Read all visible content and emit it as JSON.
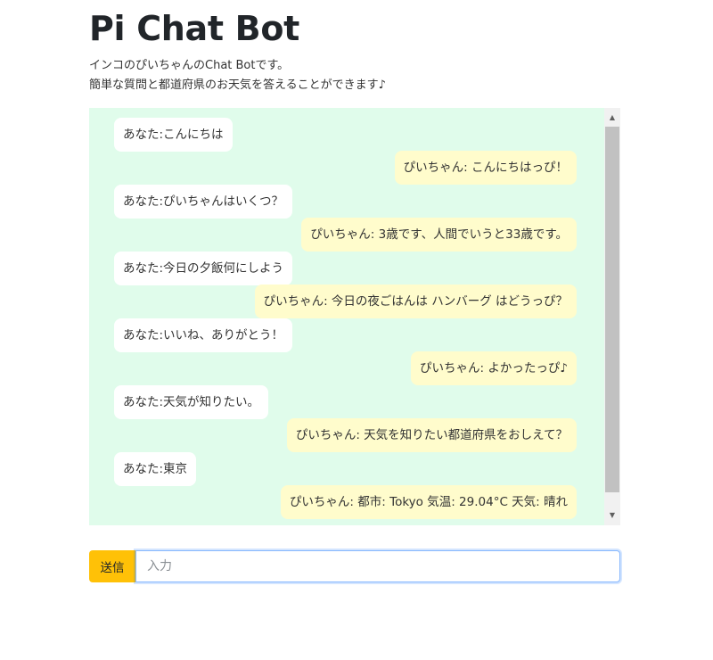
{
  "title": "Pi Chat Bot",
  "description": {
    "line1": "インコのぴいちゃんのChat Botです。",
    "line2": "簡単な質問と都道府県のお天気を答えることができます♪"
  },
  "messages": [
    {
      "role": "user",
      "text": "あなた:こんにちは"
    },
    {
      "role": "bot",
      "text": "ぴいちゃん: こんにちはっぴ！"
    },
    {
      "role": "user",
      "text": "あなた:ぴいちゃんはいくつ？"
    },
    {
      "role": "bot",
      "text": "ぴいちゃん: 3歳です、人間でいうと33歳です。"
    },
    {
      "role": "user",
      "text": "あなた:今日の夕飯何にしよう"
    },
    {
      "role": "bot",
      "text": "ぴいちゃん: 今日の夜ごはんは ハンバーグ はどうっぴ？"
    },
    {
      "role": "user",
      "text": "あなた:いいね、ありがとう！"
    },
    {
      "role": "bot",
      "text": "ぴいちゃん: よかったっぴ♪"
    },
    {
      "role": "user",
      "text": "あなた:天気が知りたい。"
    },
    {
      "role": "bot",
      "text": "ぴいちゃん: 天気を知りたい都道府県をおしえて？"
    },
    {
      "role": "user",
      "text": "あなた:東京"
    },
    {
      "role": "bot",
      "text": "ぴいちゃん: 都市: Tokyo 気温: 29.04°C 天気: 晴れ"
    }
  ],
  "input": {
    "send_label": "送信",
    "placeholder": "入力",
    "value": ""
  },
  "colors": {
    "chat_background": "#e0fceb",
    "user_bubble": "#ffffff",
    "bot_bubble": "#fffccc",
    "send_button": "#ffc107"
  }
}
